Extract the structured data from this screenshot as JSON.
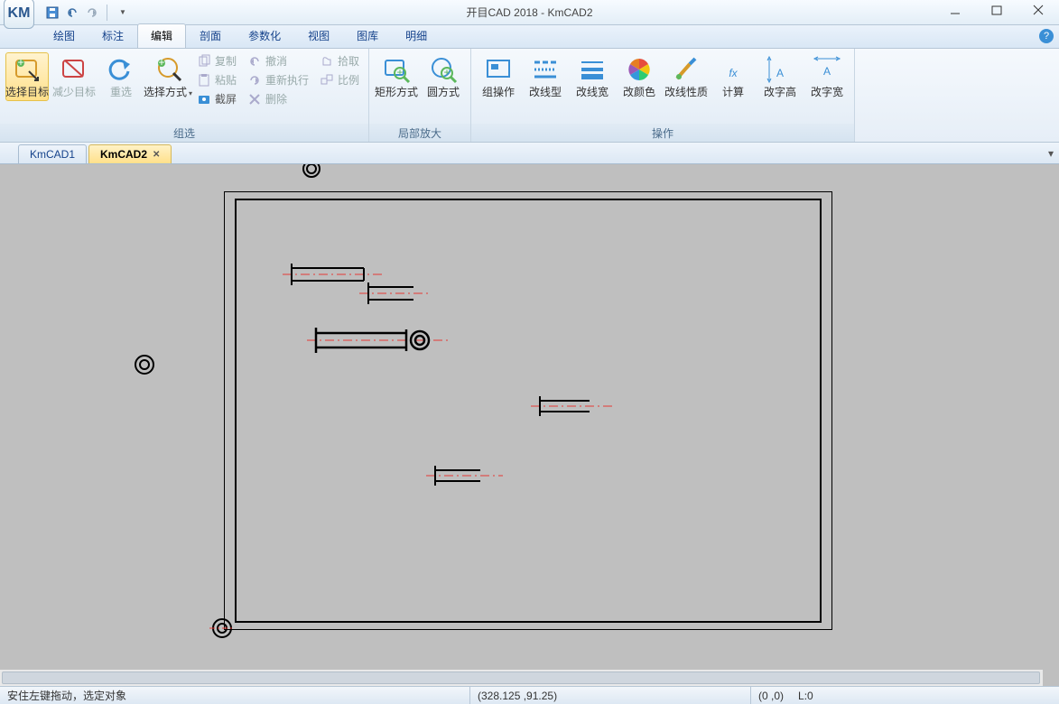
{
  "app": {
    "logo_text": "KM",
    "title": "开目CAD 2018 - KmCAD2"
  },
  "qat": {
    "save": "save",
    "undo": "undo",
    "redo": "redo"
  },
  "menus": {
    "items": [
      "绘图",
      "标注",
      "编辑",
      "剖面",
      "参数化",
      "视图",
      "图库",
      "明细"
    ],
    "active_index": 2
  },
  "ribbon": {
    "group_selection": {
      "label": "组选",
      "select_target": "选择目标",
      "reduce_target": "减少目标",
      "reselect": "重选",
      "select_mode": "选择方式",
      "copy": "复制",
      "paste": "粘贴",
      "screenshot": "截屏",
      "undo": "撤消",
      "redo_exec": "重新执行",
      "delete": "删除",
      "pickup": "拾取",
      "scale": "比例"
    },
    "group_zoom": {
      "label": "局部放大",
      "rect_mode": "矩形方式",
      "circle_mode": "圆方式"
    },
    "group_ops": {
      "label": "操作",
      "group_op": "组操作",
      "line_type": "改线型",
      "line_width": "改线宽",
      "color": "改颜色",
      "line_prop": "改线性质",
      "calc": "计算",
      "char_height": "改字高",
      "char_width": "改字宽"
    }
  },
  "tabs": {
    "items": [
      {
        "label": "KmCAD1",
        "active": false,
        "closeable": false
      },
      {
        "label": "KmCAD2",
        "active": true,
        "closeable": true
      }
    ]
  },
  "status": {
    "hint": "安住左键拖动，选定对象",
    "coords": "(328.125 ,91.25)",
    "origin": "(0 ,0)",
    "layer": "L:0"
  }
}
